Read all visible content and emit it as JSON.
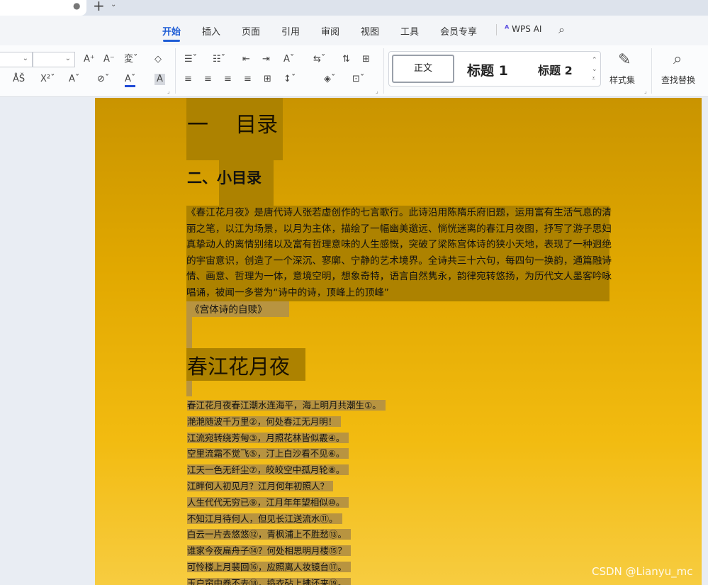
{
  "tabbar": {
    "close_glyph": "●",
    "new_tab_glyph": "+",
    "new_tab_dropdown": "⌄"
  },
  "menu": {
    "items": [
      "开始",
      "插入",
      "页面",
      "引用",
      "审阅",
      "视图",
      "工具",
      "会员专享"
    ],
    "active": "开始",
    "wps_ai": "WPS AI",
    "wps_ai_icon": "ᴬ"
  },
  "ribbon": {
    "row1": [
      "A⁺",
      "A⁻",
      "変ˇ",
      "◇"
    ],
    "row2": [
      "ÅŠ",
      "X²ˇ",
      "Aˇ",
      "⊘ˇ",
      "Aˇ",
      "A"
    ],
    "para_row1": [
      "☰ˇ",
      "☷ˇ",
      "⇤",
      "⇥",
      "Aˇ",
      "⇆ˇ",
      "⇅",
      "⊞"
    ],
    "para_row2": [
      "≡",
      "≡",
      "≡",
      "≡",
      "⊞",
      "↕ˇ",
      "◈ˇ",
      "⊡ˇ"
    ],
    "styles": {
      "normal": "正文",
      "heading1": "标题 1",
      "heading2": "标题 2"
    },
    "style_set": "样式集",
    "find_replace": "查找替换"
  },
  "document": {
    "heading1": "一    目录",
    "heading2": "二、小目录",
    "paragraph": "《春江花月夜》是唐代诗人张若虚创作的七言歌行。此诗沿用陈隋乐府旧题，运用富有生活气息的清丽之笔，以江为场景，以月为主体，描绘了一幅幽美邈远、惝恍迷离的春江月夜图，抒写了游子思妇真挚动人的离情别绪以及富有哲理意味的人生感慨，突破了梁陈宫体诗的狭小天地，表现了一种迥绝的宇宙意识，创造了一个深沉、寥廓、宁静的艺术境界。全诗共三十六句，每四句一换韵，通篇融诗情、画意、哲理为一体，意境空明，想象奇特，语言自然隽永，韵律宛转悠扬，为历代文人墨客吟咏唱诵，被闻一多誉为“诗中的诗，顶峰上的顶峰”",
    "toc_line": "《宫体诗的自赎》",
    "poem_title": "春江花月夜",
    "poem_lines": [
      "春江花月夜春江潮水连海平，海上明月共潮生①。",
      "滟滟随波千万里②，何处春江无月明！",
      "江流宛转绕芳甸③，月照花林皆似霰④。",
      "空里流霜不觉飞⑤，汀上白沙看不见⑥。",
      "江天一色无纤尘⑦，皎皎空中孤月轮⑧。",
      "江畔何人初见月？江月何年初照人？",
      "人生代代无穷已⑨，江月年年望相似⑩。",
      "不知江月待何人，但见长江送流水⑪。",
      "白云一片去悠悠⑫，青枫浦上不胜愁⑬。",
      "谁家今夜扁舟子⑭？何处相思明月楼⑮？",
      "可怜楼上月裴回⑯，应照离人妆镜台⑰。",
      "玉户帘中卷不去⑱，捣衣砧上拂还来⑲。"
    ]
  },
  "watermark": "CSDN @Lianyu_mc",
  "colors": {
    "accent": "#1f5dd6",
    "page_top": "#c99400",
    "page_bottom": "#f7cc40",
    "selection": "#ad8200"
  }
}
